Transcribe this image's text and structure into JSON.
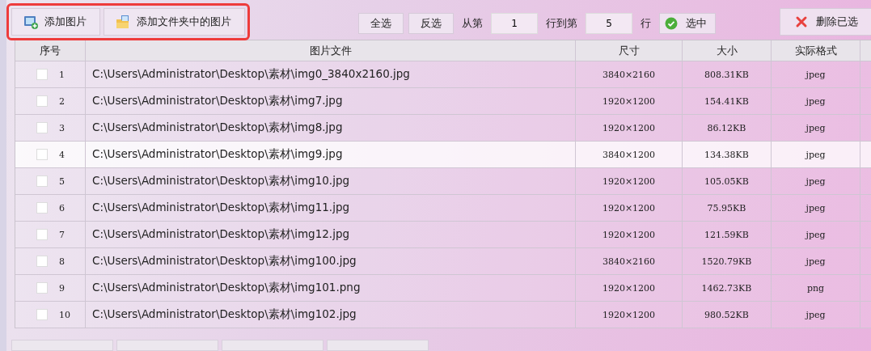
{
  "toolbar": {
    "add_buttons": [
      {
        "label": "添加图片",
        "kind": "image"
      },
      {
        "label": "添加文件夹中的图片",
        "kind": "folder"
      }
    ],
    "highlighted": true,
    "select_all": "全选",
    "invert": "反选",
    "from_label": "从第",
    "from_value": "1",
    "to_label": "行到第",
    "to_value": "5",
    "row_label": "行",
    "select_button": "选中",
    "delete_button": "删除已选"
  },
  "table": {
    "columns": [
      "序号",
      "图片文件",
      "尺寸",
      "大小",
      "实际格式"
    ],
    "rows": [
      {
        "index": "1",
        "file": "C:\\Users\\Administrator\\Desktop\\素材\\img0_3840x2160.jpg",
        "dimensions": "3840×2160",
        "size": "808.31KB",
        "format": "jpeg",
        "checked": false,
        "selected": false
      },
      {
        "index": "2",
        "file": "C:\\Users\\Administrator\\Desktop\\素材\\img7.jpg",
        "dimensions": "1920×1200",
        "size": "154.41KB",
        "format": "jpeg",
        "checked": false,
        "selected": false
      },
      {
        "index": "3",
        "file": "C:\\Users\\Administrator\\Desktop\\素材\\img8.jpg",
        "dimensions": "1920×1200",
        "size": "86.12KB",
        "format": "jpeg",
        "checked": false,
        "selected": false
      },
      {
        "index": "4",
        "file": "C:\\Users\\Administrator\\Desktop\\素材\\img9.jpg",
        "dimensions": "3840×1200",
        "size": "134.38KB",
        "format": "jpeg",
        "checked": false,
        "selected": true
      },
      {
        "index": "5",
        "file": "C:\\Users\\Administrator\\Desktop\\素材\\img10.jpg",
        "dimensions": "1920×1200",
        "size": "105.05KB",
        "format": "jpeg",
        "checked": false,
        "selected": false
      },
      {
        "index": "6",
        "file": "C:\\Users\\Administrator\\Desktop\\素材\\img11.jpg",
        "dimensions": "1920×1200",
        "size": "75.95KB",
        "format": "jpeg",
        "checked": false,
        "selected": false
      },
      {
        "index": "7",
        "file": "C:\\Users\\Administrator\\Desktop\\素材\\img12.jpg",
        "dimensions": "1920×1200",
        "size": "121.59KB",
        "format": "jpeg",
        "checked": false,
        "selected": false
      },
      {
        "index": "8",
        "file": "C:\\Users\\Administrator\\Desktop\\素材\\img100.jpg",
        "dimensions": "3840×2160",
        "size": "1520.79KB",
        "format": "jpeg",
        "checked": false,
        "selected": false
      },
      {
        "index": "9",
        "file": "C:\\Users\\Administrator\\Desktop\\素材\\img101.png",
        "dimensions": "1920×1200",
        "size": "1462.73KB",
        "format": "png",
        "checked": false,
        "selected": false
      },
      {
        "index": "10",
        "file": "C:\\Users\\Administrator\\Desktop\\素材\\img102.jpg",
        "dimensions": "1920×1200",
        "size": "980.52KB",
        "format": "jpeg",
        "checked": false,
        "selected": false
      }
    ]
  }
}
